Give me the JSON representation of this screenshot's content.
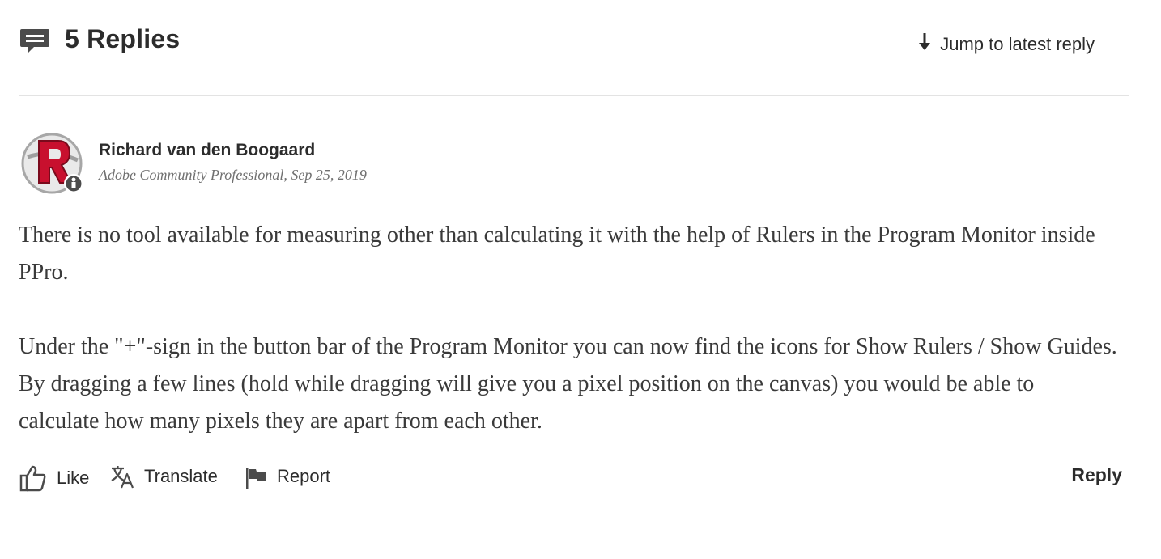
{
  "header": {
    "replies_title": "5 Replies",
    "jump_label": "Jump to latest reply",
    "comment_icon": "comment-icon",
    "jump_icon": "arrow-down-icon"
  },
  "post": {
    "author": "Richard van den Boogaard",
    "role": "Adobe Community Professional",
    "date_sep": ", ",
    "date": "Sep 25, 2019",
    "paragraphs": [
      "There is no tool available for measuring other than calculating it with the help of Rulers in the Program Monitor inside PPro.",
      "Under the \"+\"-sign in the button bar of the Program Monitor you can now find the icons for Show Rulers / Show Guides. By dragging a few lines (hold while dragging will give you a pixel position on the canvas) you would be able to calculate how many pixels they are apart from each other."
    ]
  },
  "actions": {
    "like": "Like",
    "translate": "Translate",
    "report": "Report",
    "reply": "Reply"
  },
  "colors": {
    "text": "#2c2c2c",
    "meta": "#707070",
    "avatar_red": "#c8102e",
    "divider": "#e3e3e3"
  }
}
